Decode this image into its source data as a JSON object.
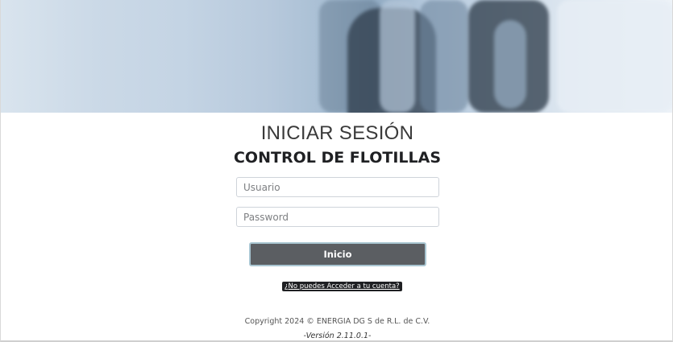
{
  "header": {
    "title": "INICIAR SESIÓN",
    "subtitle": "CONTROL DE FLOTILLAS"
  },
  "form": {
    "username_placeholder": "Usuario",
    "username_value": "",
    "password_placeholder": "Password",
    "password_value": "",
    "submit_label": "Inicio",
    "help_link_label": "¿No puedes Acceder a tu cuenta?"
  },
  "footer": {
    "copyright": "Copyright 2024 © ENERGIA DG S de R.L. de C.V.",
    "version": "-Versión 2.11.0.1-"
  },
  "colors": {
    "button_bg": "#5b5e62",
    "button_border": "#a9c6d2",
    "help_link_bg": "#1f2023"
  }
}
